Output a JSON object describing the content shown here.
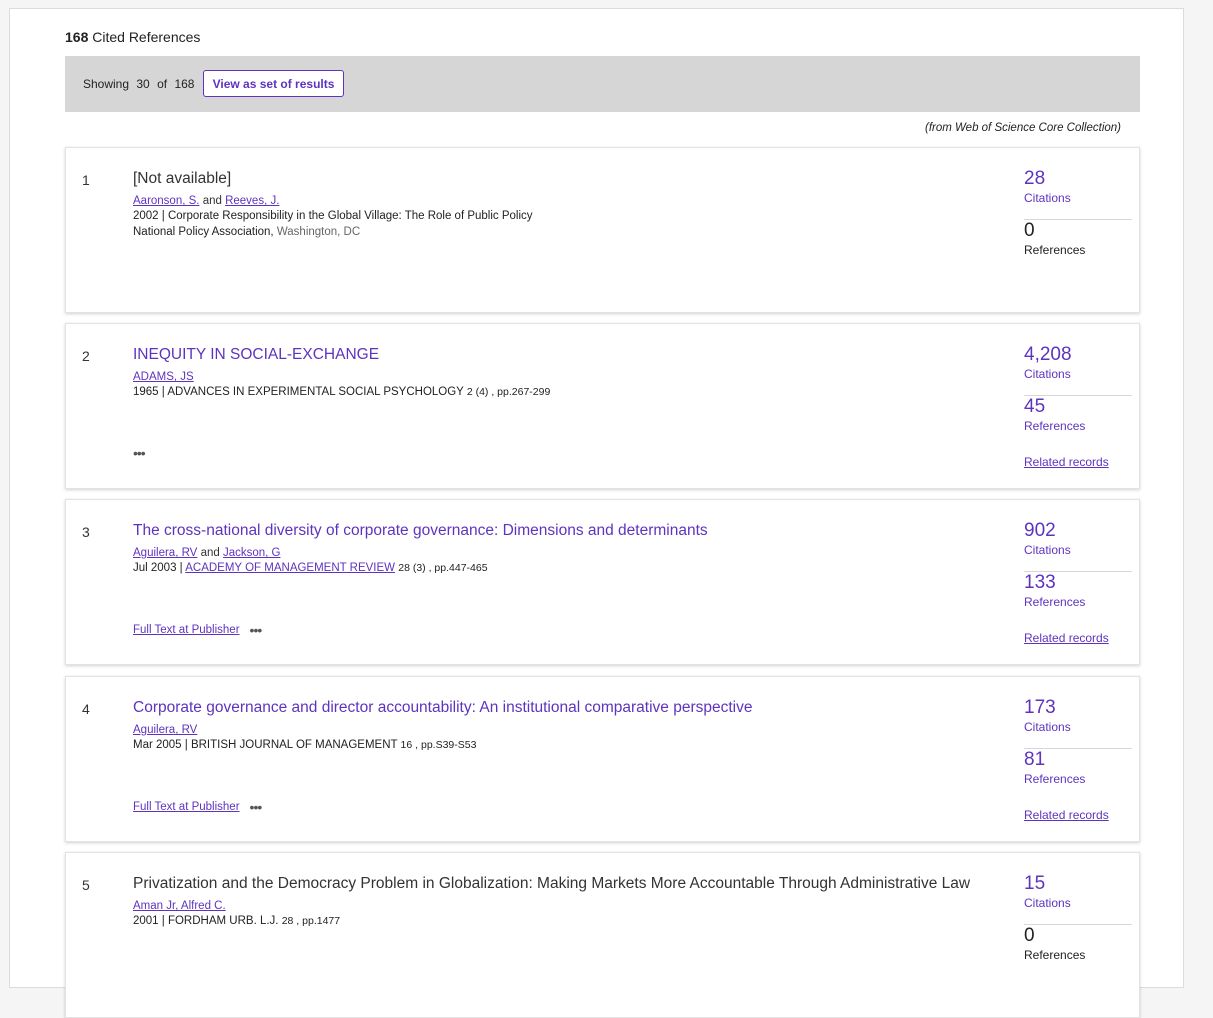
{
  "header": {
    "count": "168",
    "label": "Cited References"
  },
  "bar": {
    "showing_label": "Showing",
    "shown": "30",
    "of_label": "of",
    "total": "168",
    "view_button": "View as set of results"
  },
  "source_note": "(from Web of Science Core Collection)",
  "references": [
    {
      "num": "1",
      "title": "[Not available]",
      "authors": [
        "Aaronson, S.",
        "Reeves, J."
      ],
      "joiner": "and",
      "pub_line": "2002 | Corporate Responsibility in the Global Village: The Role of Public Policy",
      "publisher": "National Policy Association,",
      "location": "Washington, DC",
      "citations": "28",
      "citations_label": "Citations",
      "references_count": "0",
      "references_label": "References"
    },
    {
      "num": "2",
      "title": "INEQUITY IN SOCIAL-EXCHANGE",
      "authors": [
        "ADAMS, JS"
      ],
      "pub_date": "1965 | ADVANCES IN EXPERIMENTAL SOCIAL PSYCHOLOGY",
      "pub_detail": "2 (4) , pp.267-299",
      "more": "•••",
      "citations": "4,208",
      "citations_label": "Citations",
      "references_count": "45",
      "references_label": "References",
      "related": "Related records"
    },
    {
      "num": "3",
      "title": "The cross-national diversity of corporate governance: Dimensions and determinants",
      "authors": [
        "Aguilera, RV",
        "Jackson, G"
      ],
      "joiner": "and",
      "pub_date": "Jul 2003 |",
      "journal": "ACADEMY OF MANAGEMENT REVIEW",
      "pub_detail": "28 (3) , pp.447-465",
      "full_text": "Full Text at Publisher",
      "more": "•••",
      "citations": "902",
      "citations_label": "Citations",
      "references_count": "133",
      "references_label": "References",
      "related": "Related records"
    },
    {
      "num": "4",
      "title": "Corporate governance and director accountability: An institutional comparative perspective",
      "authors": [
        "Aguilera, RV"
      ],
      "pub_date": "Mar 2005 | BRITISH JOURNAL OF MANAGEMENT",
      "pub_detail": "16 , pp.S39-S53",
      "full_text": "Full Text at Publisher",
      "more": "•••",
      "citations": "173",
      "citations_label": "Citations",
      "references_count": "81",
      "references_label": "References",
      "related": "Related records"
    },
    {
      "num": "5",
      "title": "Privatization and the Democracy Problem in Globalization: Making Markets More Accountable Through Administrative Law",
      "authors": [
        "Aman Jr, Alfred C."
      ],
      "pub_date": "2001 | FORDHAM URB. L.J.",
      "pub_detail": "28 , pp.1477",
      "citations": "15",
      "citations_label": "Citations",
      "references_count": "0",
      "references_label": "References"
    }
  ],
  "colors": {
    "accent": "#5e33bf",
    "bar_bg": "#d6d6d6",
    "page_bg": "#f5f5f5"
  }
}
